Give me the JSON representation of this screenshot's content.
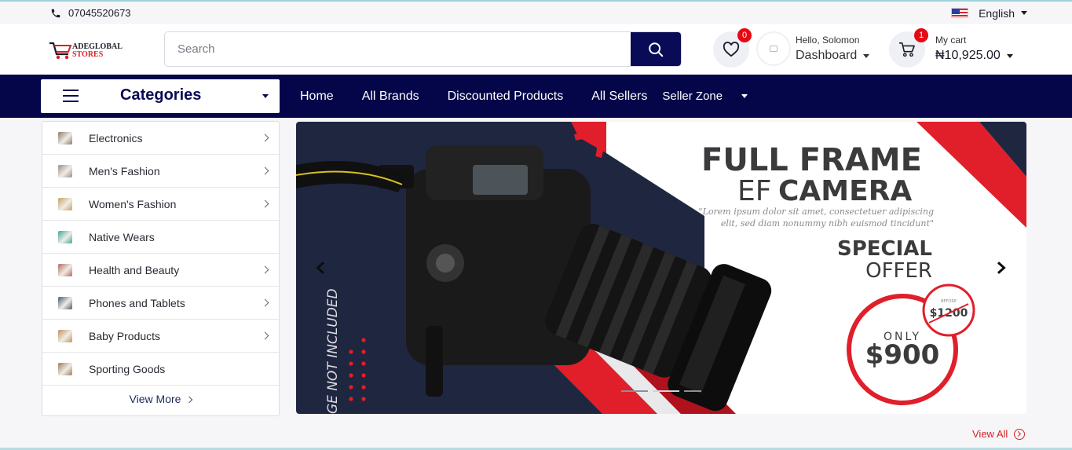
{
  "topbar": {
    "phone": "07045520673",
    "language": "English",
    "icons": {
      "phone": "phone-icon",
      "flag": "us-flag-icon"
    }
  },
  "header": {
    "logo": {
      "line1": "ADEGLOBAL",
      "line2": "STORES"
    },
    "search": {
      "placeholder": "Search",
      "value": ""
    },
    "wishlist": {
      "count": "0"
    },
    "user": {
      "greeting": "Hello, Solomon",
      "menu_label": "Dashboard"
    },
    "cart": {
      "label": "My cart",
      "total": "₦10,925.00",
      "count": "1"
    }
  },
  "nav": {
    "categories_label": "Categories",
    "links": [
      "Home",
      "All Brands",
      "Discounted Products",
      "All Sellers"
    ],
    "seller_zone": "Seller Zone"
  },
  "categories": {
    "items": [
      {
        "label": "Electronics",
        "has_sub": true,
        "color": "#8a7a6a"
      },
      {
        "label": "Men's Fashion",
        "has_sub": true,
        "color": "#9a8f86"
      },
      {
        "label": "Women's Fashion",
        "has_sub": true,
        "color": "#c8a060"
      },
      {
        "label": "Native Wears",
        "has_sub": false,
        "color": "#3aa89a"
      },
      {
        "label": "Health and Beauty",
        "has_sub": true,
        "color": "#b06a5a"
      },
      {
        "label": "Phones and Tablets",
        "has_sub": true,
        "color": "#4a5a6a"
      },
      {
        "label": "Baby Products",
        "has_sub": true,
        "color": "#c09060"
      },
      {
        "label": "Sporting Goods",
        "has_sub": false,
        "color": "#a07a5a"
      }
    ],
    "view_more": "View More"
  },
  "banner": {
    "heading_line1": "FULL FRAME",
    "heading_line2_a": "EF",
    "heading_line2_b": "CAMERA",
    "tagline_1": "\"Lorem ipsum dolor sit amet, consectetuer adipiscing",
    "tagline_2": "elit, sed diam nonummy nibh euismod tincidunt\"",
    "offer_1": "SPECIAL",
    "offer_2": "OFFER",
    "before_label": "BEFORE",
    "old_price": "$1200",
    "only_label": "ONLY",
    "price": "$900",
    "side_text": "GE NOT INCLUDED",
    "colors": {
      "navy": "#1f2640",
      "red": "#e01f2a"
    }
  },
  "footer": {
    "view_all": "View All"
  }
}
